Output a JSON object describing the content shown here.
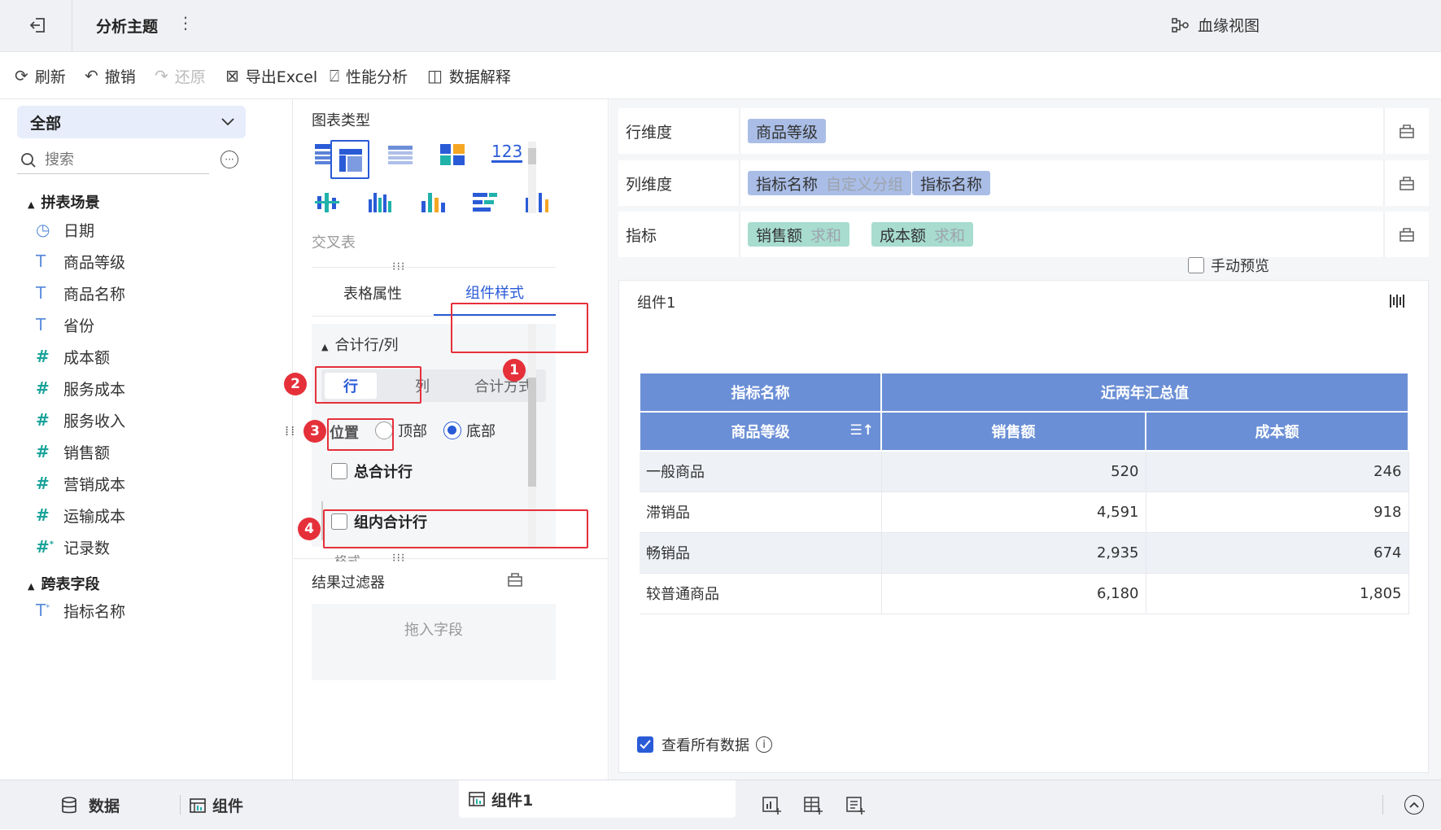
{
  "topbar": {
    "title": "分析主题",
    "lineage_label": "血缘视图"
  },
  "toolbar": {
    "refresh": "刷新",
    "undo": "撤销",
    "redo": "还原",
    "export": "导出Excel",
    "perf": "性能分析",
    "explain": "数据解释"
  },
  "left_panel": {
    "scope_select": "全部",
    "search_placeholder": "搜索",
    "groups": [
      {
        "title": "拼表场景",
        "items": [
          {
            "type": "date",
            "label": "日期"
          },
          {
            "type": "text",
            "label": "商品等级"
          },
          {
            "type": "text",
            "label": "商品名称"
          },
          {
            "type": "text",
            "label": "省份"
          },
          {
            "type": "number",
            "label": "成本额"
          },
          {
            "type": "number",
            "label": "服务成本"
          },
          {
            "type": "number",
            "label": "服务收入"
          },
          {
            "type": "number",
            "label": "销售额"
          },
          {
            "type": "number",
            "label": "营销成本"
          },
          {
            "type": "number",
            "label": "运输成本"
          },
          {
            "type": "number-calc",
            "label": "记录数"
          }
        ]
      },
      {
        "title": "跨表字段",
        "items": [
          {
            "type": "text-calc",
            "label": "指标名称"
          }
        ]
      }
    ]
  },
  "middle_panel": {
    "chart_type_title": "图表类型",
    "chart_type_selected": "交叉表",
    "tabs": [
      "表格属性",
      "组件样式"
    ],
    "section_title": "合计行/列",
    "sub_tabs": [
      "行",
      "列",
      "合计方式"
    ],
    "position_label": "位置",
    "position_options": [
      "顶部",
      "底部"
    ],
    "position_selected": "底部",
    "grand_total_label": "总合计行",
    "group_total_label": "组内合计行",
    "cut_text": "格式",
    "filter_title": "结果过滤器",
    "filter_placeholder": "拖入字段"
  },
  "annotations": [
    "1",
    "2",
    "3",
    "4"
  ],
  "right_panel": {
    "row_dim_label": "行维度",
    "row_dims": [
      {
        "name": "商品等级"
      }
    ],
    "col_dim_label": "列维度",
    "col_dims": [
      {
        "name": "指标名称",
        "sub": "自定义分组"
      },
      {
        "name": "指标名称"
      }
    ],
    "measure_label": "指标",
    "measures": [
      {
        "name": "销售额",
        "sub": "求和"
      },
      {
        "name": "成本额",
        "sub": "求和"
      }
    ],
    "manual_preview": "手动预览",
    "component_title": "组件1",
    "table": {
      "header1": [
        "指标名称",
        "近两年汇总值"
      ],
      "header2": [
        "商品等级",
        "销售额",
        "成本额"
      ],
      "rows": [
        [
          "一般商品",
          "520",
          "246"
        ],
        [
          "滞销品",
          "4,591",
          "918"
        ],
        [
          "畅销品",
          "2,935",
          "674"
        ],
        [
          "较普通商品",
          "6,180",
          "1,805"
        ]
      ]
    },
    "view_all_label": "查看所有数据"
  },
  "bottom_bar": {
    "data_tab": "数据",
    "component_tab": "组件",
    "active_tab": "组件1"
  },
  "colors": {
    "accent": "#2a5bd7",
    "header_blue": "#6b8fd6",
    "annotation_red": "#e5303a",
    "chip_blue": "#a9bde6",
    "chip_green": "#a7dccf"
  }
}
